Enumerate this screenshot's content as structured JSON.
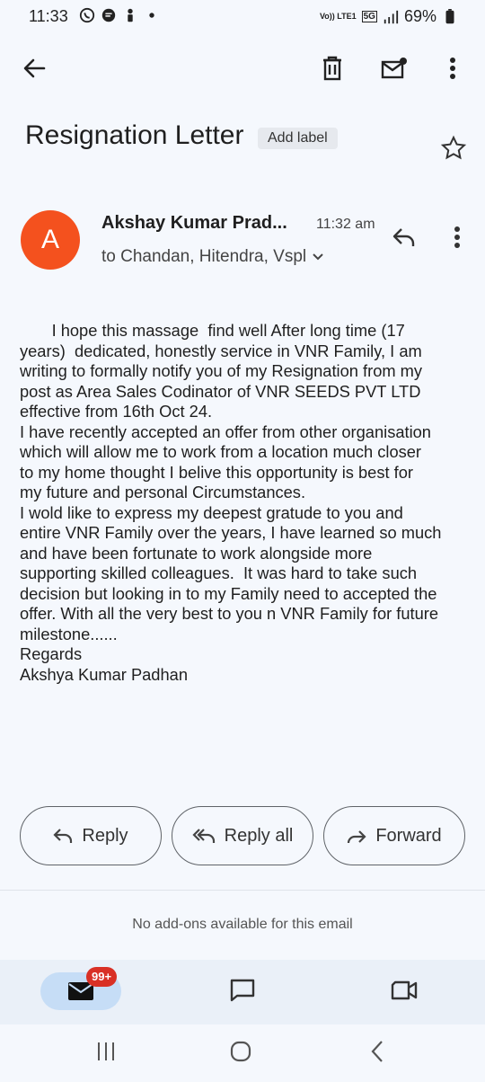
{
  "status_bar": {
    "time": "11:33",
    "battery": "69%",
    "network_label": "Vo)) LTE1",
    "signal_label": "5G"
  },
  "toolbar": {
    "back_icon": "arrow-left-icon",
    "delete_icon": "trash-icon",
    "mark_unread_icon": "mail-dot-icon",
    "more_icon": "more-vert-icon"
  },
  "email": {
    "subject": "Resignation Letter",
    "add_label": "Add label",
    "sender_initial": "A",
    "sender": "Akshay Kumar Prad...",
    "time": "11:32 am",
    "recipients": "to Chandan, Hitendra, Vspl",
    "body": "       I hope this massage  find well After long time (17\nyears)  dedicated, honestly service in VNR Family, I am\nwriting to formally notify you of my Resignation from my\npost as Area Sales Codinator of VNR SEEDS PVT LTD\neffective from 16th Oct 24.\nI have recently accepted an offer from other organisation\nwhich will allow me to work from a location much closer\nto my home thought I belive this opportunity is best for\nmy future and personal Circumstances.\nI wold like to express my deepest gratude to you and\nentire VNR Family over the years, I have learned so much\nand have been fortunate to work alongside more\nsupporting skilled colleagues.  It was hard to take such\ndecision but looking in to my Family need to accepted the\noffer. With all the very best to you n VNR Family for future\nmilestone......\nRegards\nAkshya Kumar Padhan"
  },
  "actions": {
    "reply": "Reply",
    "reply_all": "Reply all",
    "forward": "Forward"
  },
  "addons_text": "No add-ons available for this email",
  "bottom_nav": {
    "mail_badge": "99+"
  },
  "colors": {
    "avatar": "#f4511e",
    "badge": "#d93025",
    "accent_pill": "#c6ddf6"
  }
}
